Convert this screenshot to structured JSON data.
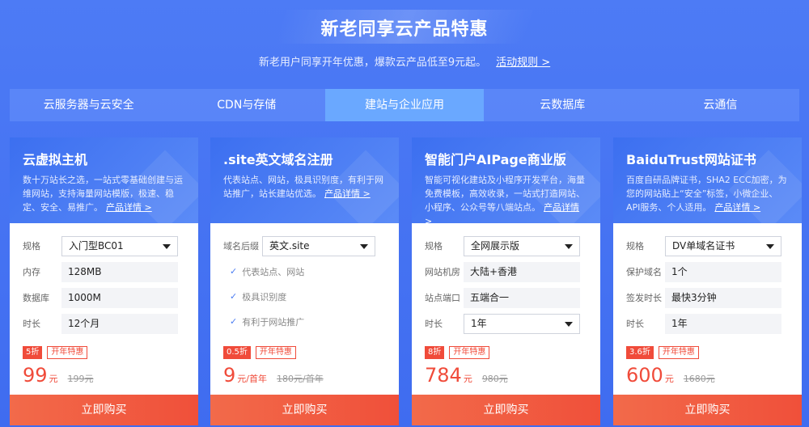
{
  "hero": {
    "title": "新老同享云产品特惠",
    "subtitle": "新老用户同享开年优惠，爆款云产品低至9元起。",
    "rules_link": "活动规则 >"
  },
  "tabs": [
    {
      "label": "云服务器与云安全"
    },
    {
      "label": "CDN与存储"
    },
    {
      "label": "建站与企业应用",
      "active": true
    },
    {
      "label": "云数据库"
    },
    {
      "label": "云通信"
    }
  ],
  "detail_link_label": "产品详情 >",
  "buy_label": "立即购买",
  "cards": [
    {
      "title": "云虚拟主机",
      "desc": "数十万站长之选，一站式零基础创建与运维网站，支持海量网站模版，极速、稳定、安全、易推广。",
      "rows": [
        {
          "label": "规格",
          "value": "入门型BC01",
          "type": "select"
        },
        {
          "label": "内存",
          "value": "128MB",
          "type": "text"
        },
        {
          "label": "数据库",
          "value": "1000M",
          "type": "text"
        },
        {
          "label": "时长",
          "value": "12个月",
          "type": "text"
        }
      ],
      "discount": "5折",
      "tag": "开年特惠",
      "price": "99",
      "unit": "元",
      "original": "199元"
    },
    {
      "title": ".site英文域名注册",
      "desc": "代表站点、网站，极具识别度，有利于网站推广，站长建站优选。",
      "rows": [
        {
          "label": "域名后缀",
          "value": "英文.site",
          "type": "select"
        }
      ],
      "features": [
        "代表站点、网站",
        "极具识别度",
        "有利于网站推广"
      ],
      "discount": "0.5折",
      "tag": "开年特惠",
      "price": "9",
      "unit": "元/首年",
      "original": "180元/首年"
    },
    {
      "title": "智能门户AIPage商业版",
      "desc": "智能可视化建站及小程序开发平台，海量免费模板，高效收录，一站式打造网站、小程序、公众号等八端站点。",
      "rows": [
        {
          "label": "规格",
          "value": "全网展示版",
          "type": "select"
        },
        {
          "label": "网站机房",
          "value": "大陆+香港",
          "type": "text"
        },
        {
          "label": "站点端口",
          "value": "五端合一",
          "type": "text"
        },
        {
          "label": "时长",
          "value": "1年",
          "type": "select"
        }
      ],
      "discount": "8折",
      "tag": "开年特惠",
      "price": "784",
      "unit": "元",
      "original": "980元"
    },
    {
      "title": "BaiduTrust网站证书",
      "desc": "百度自研品牌证书，SHA2 ECC加密，为您的网站贴上“安全”标签，小微企业、API服务、个人适用。",
      "rows": [
        {
          "label": "规格",
          "value": "DV单域名证书",
          "type": "select"
        },
        {
          "label": "保护域名",
          "value": "1个",
          "type": "text"
        },
        {
          "label": "签发时长",
          "value": "最快3分钟",
          "type": "text"
        },
        {
          "label": "时长",
          "value": "1年",
          "type": "text"
        }
      ],
      "discount": "3.6折",
      "tag": "开年特惠",
      "price": "600",
      "unit": "元",
      "original": "1680元"
    }
  ]
}
